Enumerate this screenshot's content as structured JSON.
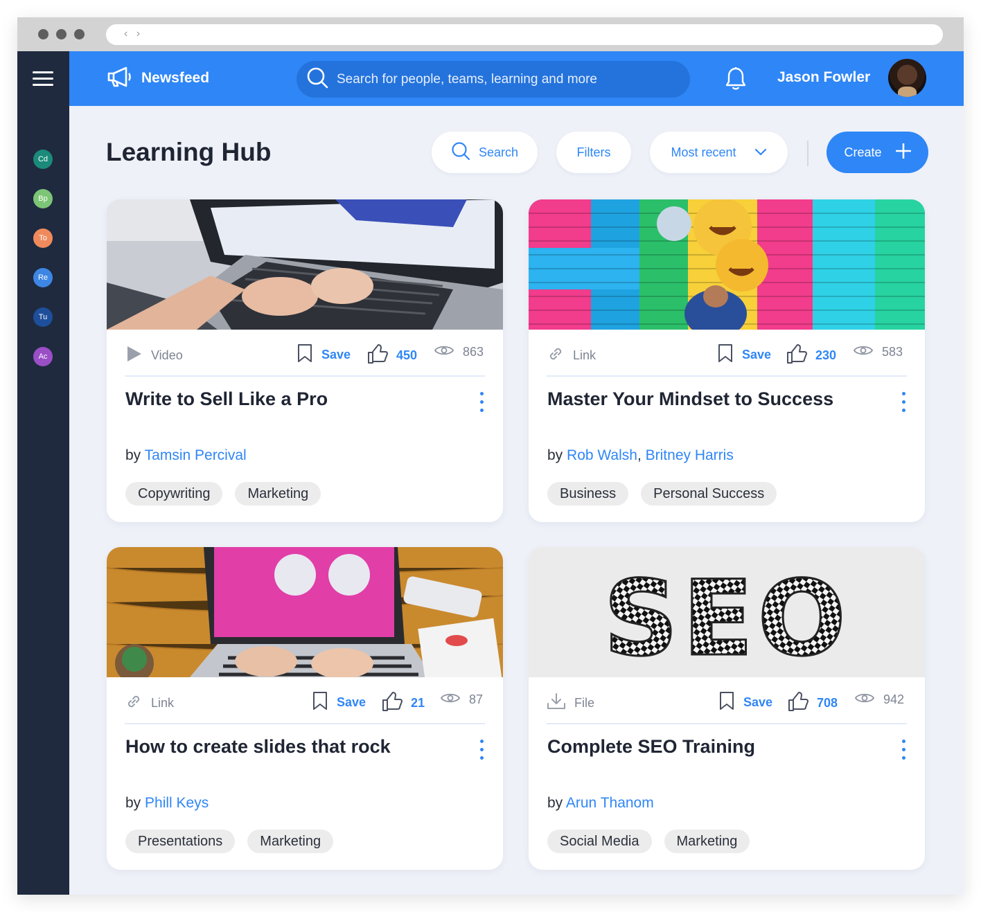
{
  "app": {
    "brand": "Newsfeed",
    "search_placeholder": "Search for people, teams, learning and more",
    "user_name": "Jason Fowler"
  },
  "sidebar": {
    "teams": [
      {
        "label": "Cd",
        "color": "#1b8a7a"
      },
      {
        "label": "Bp",
        "color": "#7cc576"
      },
      {
        "label": "To",
        "color": "#f08a5d"
      },
      {
        "label": "Re",
        "color": "#3d86e4"
      },
      {
        "label": "Tu",
        "color": "#1e4f9b"
      },
      {
        "label": "Ac",
        "color": "#9a4fc6"
      }
    ]
  },
  "page": {
    "title": "Learning Hub",
    "search_label": "Search",
    "filters_label": "Filters",
    "sort_label": "Most recent",
    "create_label": "Create"
  },
  "cards": [
    {
      "type": "Video",
      "type_icon": "play-icon",
      "save": "Save",
      "likes": "450",
      "views": "863",
      "title": "Write to Sell Like a Pro",
      "by": "by",
      "authors": [
        "Tamsin Percival"
      ],
      "tags": [
        "Copywriting",
        "Marketing"
      ]
    },
    {
      "type": "Link",
      "type_icon": "link-icon",
      "save": "Save",
      "likes": "230",
      "views": "583",
      "title": "Master Your Mindset to Success",
      "by": "by",
      "authors": [
        "Rob Walsh",
        "Britney Harris"
      ],
      "tags": [
        "Business",
        "Personal Success"
      ]
    },
    {
      "type": "Link",
      "type_icon": "link-icon",
      "save": "Save",
      "likes": "21",
      "views": "87",
      "title": "How to create slides that rock",
      "by": "by",
      "authors": [
        "Phill Keys"
      ],
      "tags": [
        "Presentations",
        "Marketing"
      ]
    },
    {
      "type": "File",
      "type_icon": "download-icon",
      "save": "Save",
      "likes": "708",
      "views": "942",
      "title": "Complete SEO Training",
      "by": "by",
      "authors": [
        "Arun Thanom"
      ],
      "tags": [
        "Social Media",
        "Marketing"
      ],
      "thumb_text": "SEO"
    }
  ],
  "colors": {
    "accent": "#2f86f6",
    "sidebar": "#1f2a3f",
    "background": "#eef1f8"
  }
}
